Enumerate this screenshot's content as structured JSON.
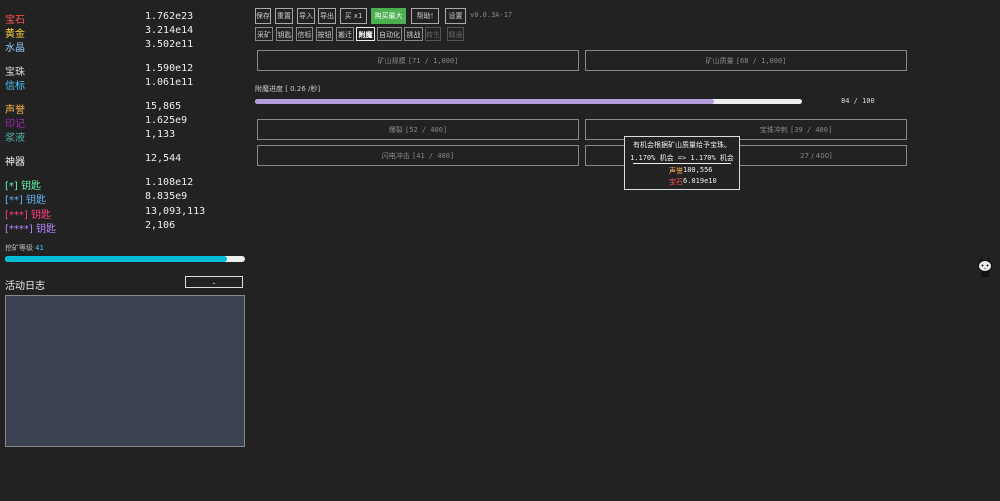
{
  "resources": [
    {
      "name": "宝石",
      "value": "1.762e23",
      "color": "#ff5252"
    },
    {
      "name": "黄金",
      "value": "3.214e14",
      "color": "#ffd740"
    },
    {
      "name": "水晶",
      "value": "3.502e11",
      "color": "#90caf9"
    },
    {
      "name": "宝珠",
      "value": "1.590e12",
      "color": "#dddddd"
    },
    {
      "name": "信标",
      "value": "1.061e11",
      "color": "#4fc3f7"
    },
    {
      "name": "声誉",
      "value": "15,865",
      "color": "#ffb74d"
    },
    {
      "name": "印记",
      "value": "1.625e9",
      "color": "#9c27b0"
    },
    {
      "name": "浆液",
      "value": "1,133",
      "color": "#4db6ac"
    },
    {
      "name": "神器",
      "value": "12,544",
      "color": "#eeeeee"
    },
    {
      "name": "[*] 钥匙",
      "value": "1.108e12",
      "color": "#69f0ae"
    },
    {
      "name": "[**] 钥匙",
      "value": "8.835e9",
      "color": "#64b5f6"
    },
    {
      "name": "[***] 钥匙",
      "value": "13,093,113",
      "color": "#ff4081"
    },
    {
      "name": "[****] 钥匙",
      "value": "2,106",
      "color": "#b388ff"
    }
  ],
  "mining": {
    "label": "挖矿等级",
    "level": "41",
    "progress": 0.925
  },
  "log": {
    "title": "活动日志",
    "toggle": "-"
  },
  "toolbar": {
    "save": "保存",
    "reset": "重置",
    "import": "导入",
    "export": "导出",
    "buy_x": "买 x1",
    "buy_max": "购买最大",
    "help": "帮助!",
    "settings": "设置",
    "version": "v0.0.3A-17"
  },
  "tabs": [
    "采矿",
    "钥匙",
    "信标",
    "按钮",
    "搬迁",
    "附魔",
    "自动化",
    "挑战",
    "转生",
    "精通"
  ],
  "active_tab": "附魔",
  "disabled_tabs": [
    "转生",
    "精通"
  ],
  "top_upgrades": [
    {
      "name": "矿山规模",
      "cost": "[71 / 1,000]"
    },
    {
      "name": "矿山质量",
      "cost": "[68 / 1,000]"
    }
  ],
  "enchant": {
    "label": "附魔进度 [ 0.26 /秒]",
    "current": 84,
    "max": 100,
    "count_text": "84 / 100"
  },
  "enchants": [
    {
      "name": "爆裂",
      "cost": "[52 / 400]"
    },
    {
      "name": "宝珠冲刺",
      "cost": "[39 / 400]"
    },
    {
      "name": "闪电冲击",
      "cost": "[41 / 400]"
    },
    {
      "name": "",
      "cost": "27 / 400]"
    }
  ],
  "tooltip": {
    "desc": "有机会根据矿山质量给予宝珠。",
    "chance": "1.170% 机会 => 1.170% 机会",
    "costs": [
      {
        "name": "声誉",
        "value": "180,556",
        "color": "#ffb74d"
      },
      {
        "name": "宝石",
        "value": "6.019e10",
        "color": "#ff5252"
      }
    ]
  }
}
